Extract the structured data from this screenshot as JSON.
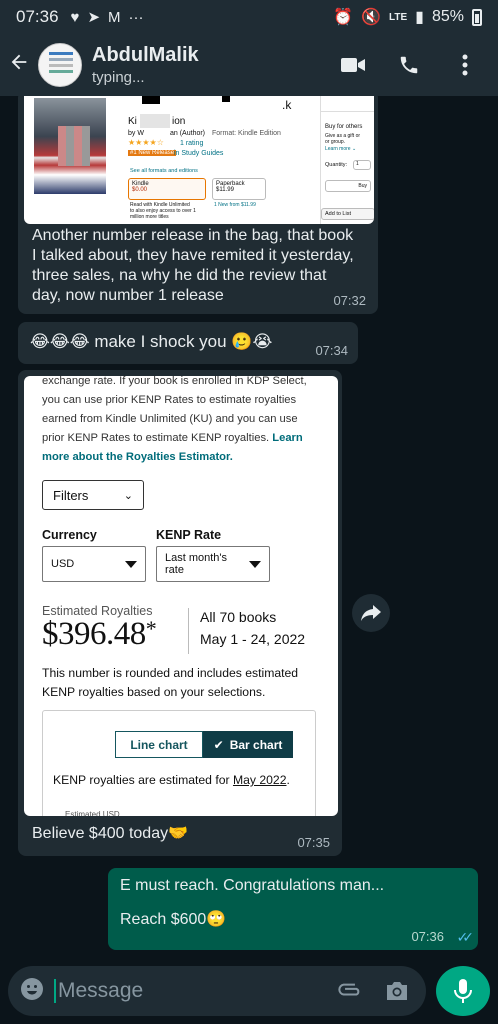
{
  "status_bar": {
    "time": "07:36",
    "network": "LTE",
    "battery": "85%"
  },
  "header": {
    "contact_name": "AbdulMalik",
    "status": "typing..."
  },
  "messages": [
    {
      "from": "contact",
      "image": {
        "title_fragment": "Ki",
        "title_fragment2": "ion",
        "title_suffix": ".k",
        "byline_by": "by W",
        "byline_author": "an (Author)",
        "byline_format": "Format: Kindle Edition",
        "rating_count": "1 rating",
        "badge": "#1 New Release",
        "badge_category": "in Study Guides",
        "see_all": "See all formats and editions",
        "format1_name": "Kindle",
        "format1_price": "$0.00",
        "format2_name": "Paperback",
        "format2_price": "$11.99",
        "ku_line1": "Read with Kindle Unlimited",
        "ku_line2": "to also enjoy access to over 1",
        "ku_line3": "million more titles",
        "new_from": "1 New from $11.99",
        "side_buy_for_others": "Buy for others",
        "side_gift": "Give as a gift or",
        "side_group": "or group.",
        "side_learn_more": "Learn more ⌄",
        "side_quantity": "Quantity:",
        "side_qty_value": "1",
        "side_buy": "Buy",
        "side_add_list": "Add to List"
      },
      "text_lines": [
        "Another number release in the bag, that book",
        "I talked about, they have remited it yesterday,",
        "three sales, na why he did the review that",
        "day, now number 1 release"
      ],
      "time": "07:32"
    },
    {
      "from": "contact",
      "text": "😂😂😂 make I shock you 🥲😭",
      "time": "07:34"
    },
    {
      "from": "contact",
      "image": {
        "para_lines": [
          "exchange rate. If your book is enrolled in KDP Select,",
          "you can use prior KENP Rates to estimate royalties",
          "earned from Kindle Unlimited (KU) and you can use",
          "prior KENP Rates to estimate KENP royalties."
        ],
        "learn_more_1": "Learn",
        "learn_more_2": "more about the Royalties Estimator.",
        "filters_label": "Filters",
        "currency_label": "Currency",
        "currency_value": "USD",
        "kenp_label": "KENP Rate",
        "kenp_value": "Last month's rate",
        "est_label": "Estimated Royalties",
        "amount": "$396.48",
        "asterisk": "*",
        "books": "All 70 books",
        "range": "May 1 - 24, 2022",
        "note_line1": "This number is rounded and includes estimated",
        "note_line2": "KENP royalties based on your selections.",
        "line_chart": "Line chart",
        "bar_chart": "Bar chart",
        "kenp_est_prefix": "KENP royalties are estimated for ",
        "kenp_est_month": "May 2022",
        "kenp_est_suffix": ".",
        "est_usd": "Estimated USD"
      },
      "text": "Believe $400 today🤝",
      "time": "07:35"
    },
    {
      "from": "me",
      "line1": "E must reach. Congratulations man...",
      "line2": "Reach $600🙄",
      "time": "07:36",
      "ticks": "✓✓"
    }
  ],
  "composer": {
    "placeholder": "Message"
  },
  "colors": {
    "header_bg": "#1f2c34",
    "chat_bg": "#0b141a",
    "incoming": "#202c33",
    "outgoing": "#005c4b",
    "accent": "#00a884",
    "read_ticks": "#53bdeb"
  },
  "icons": [
    "back-arrow-icon",
    "video-call-icon",
    "phone-icon",
    "more-vert-icon",
    "forward-icon",
    "emoji-icon",
    "attach-icon",
    "camera-icon",
    "mic-icon"
  ]
}
